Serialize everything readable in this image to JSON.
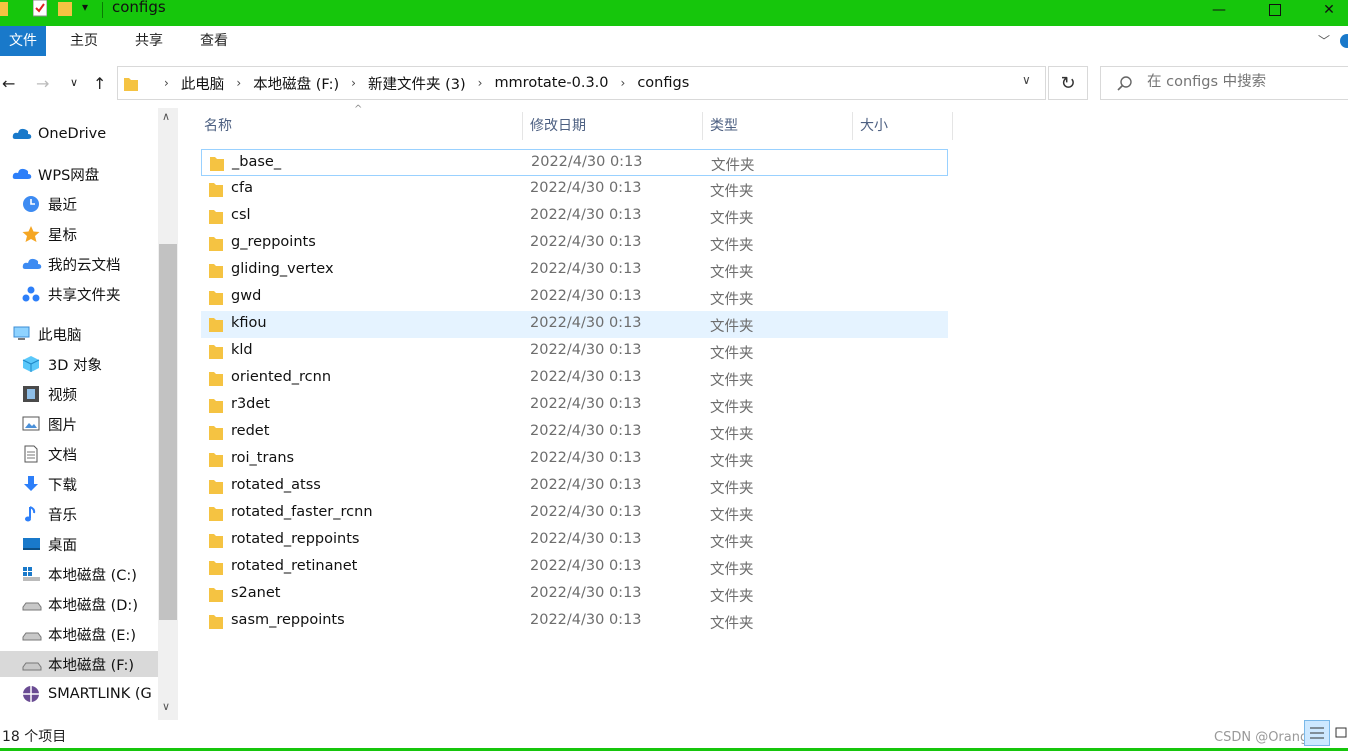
{
  "window": {
    "title": "configs",
    "accent": "#16c60c"
  },
  "ribbon": {
    "tabs": [
      "文件",
      "主页",
      "共享",
      "查看"
    ]
  },
  "address": {
    "crumbs": [
      "此电脑",
      "本地磁盘 (F:)",
      "新建文件夹 (3)",
      "mmrotate-0.3.0",
      "configs"
    ],
    "search_placeholder": "在 configs 中搜索"
  },
  "sidebar": {
    "items": [
      {
        "label": "OneDrive",
        "icon": "cloud-icon"
      },
      {
        "label": "WPS网盘",
        "icon": "wps-cloud-icon"
      },
      {
        "label": "最近",
        "icon": "clock-icon"
      },
      {
        "label": "星标",
        "icon": "star-icon"
      },
      {
        "label": "我的云文档",
        "icon": "cloud-doc-icon"
      },
      {
        "label": "共享文件夹",
        "icon": "share-folder-icon"
      },
      {
        "label": "此电脑",
        "icon": "computer-icon"
      },
      {
        "label": "3D 对象",
        "icon": "cube-icon"
      },
      {
        "label": "视频",
        "icon": "film-icon"
      },
      {
        "label": "图片",
        "icon": "picture-icon"
      },
      {
        "label": "文档",
        "icon": "document-icon"
      },
      {
        "label": "下载",
        "icon": "download-icon"
      },
      {
        "label": "音乐",
        "icon": "music-icon"
      },
      {
        "label": "桌面",
        "icon": "desktop-icon"
      },
      {
        "label": "本地磁盘 (C:)",
        "icon": "system-drive-icon"
      },
      {
        "label": "本地磁盘 (D:)",
        "icon": "drive-icon"
      },
      {
        "label": "本地磁盘 (E:)",
        "icon": "drive-icon"
      },
      {
        "label": "本地磁盘 (F:)",
        "icon": "drive-icon"
      },
      {
        "label": "SMARTLINK (G",
        "icon": "network-drive-icon"
      }
    ]
  },
  "columns": {
    "name": "名称",
    "date": "修改日期",
    "type": "类型",
    "size": "大小"
  },
  "files": [
    {
      "name": "_base_",
      "date": "2022/4/30 0:13",
      "type": "文件夹"
    },
    {
      "name": "cfa",
      "date": "2022/4/30 0:13",
      "type": "文件夹"
    },
    {
      "name": "csl",
      "date": "2022/4/30 0:13",
      "type": "文件夹"
    },
    {
      "name": "g_reppoints",
      "date": "2022/4/30 0:13",
      "type": "文件夹"
    },
    {
      "name": "gliding_vertex",
      "date": "2022/4/30 0:13",
      "type": "文件夹"
    },
    {
      "name": "gwd",
      "date": "2022/4/30 0:13",
      "type": "文件夹"
    },
    {
      "name": "kfiou",
      "date": "2022/4/30 0:13",
      "type": "文件夹"
    },
    {
      "name": "kld",
      "date": "2022/4/30 0:13",
      "type": "文件夹"
    },
    {
      "name": "oriented_rcnn",
      "date": "2022/4/30 0:13",
      "type": "文件夹"
    },
    {
      "name": "r3det",
      "date": "2022/4/30 0:13",
      "type": "文件夹"
    },
    {
      "name": "redet",
      "date": "2022/4/30 0:13",
      "type": "文件夹"
    },
    {
      "name": "roi_trans",
      "date": "2022/4/30 0:13",
      "type": "文件夹"
    },
    {
      "name": "rotated_atss",
      "date": "2022/4/30 0:13",
      "type": "文件夹"
    },
    {
      "name": "rotated_faster_rcnn",
      "date": "2022/4/30 0:13",
      "type": "文件夹"
    },
    {
      "name": "rotated_reppoints",
      "date": "2022/4/30 0:13",
      "type": "文件夹"
    },
    {
      "name": "rotated_retinanet",
      "date": "2022/4/30 0:13",
      "type": "文件夹"
    },
    {
      "name": "s2anet",
      "date": "2022/4/30 0:13",
      "type": "文件夹"
    },
    {
      "name": "sasm_reppoints",
      "date": "2022/4/30 0:13",
      "type": "文件夹"
    }
  ],
  "status": {
    "count": "18 个项目",
    "watermark": "CSDN @Orange三"
  }
}
